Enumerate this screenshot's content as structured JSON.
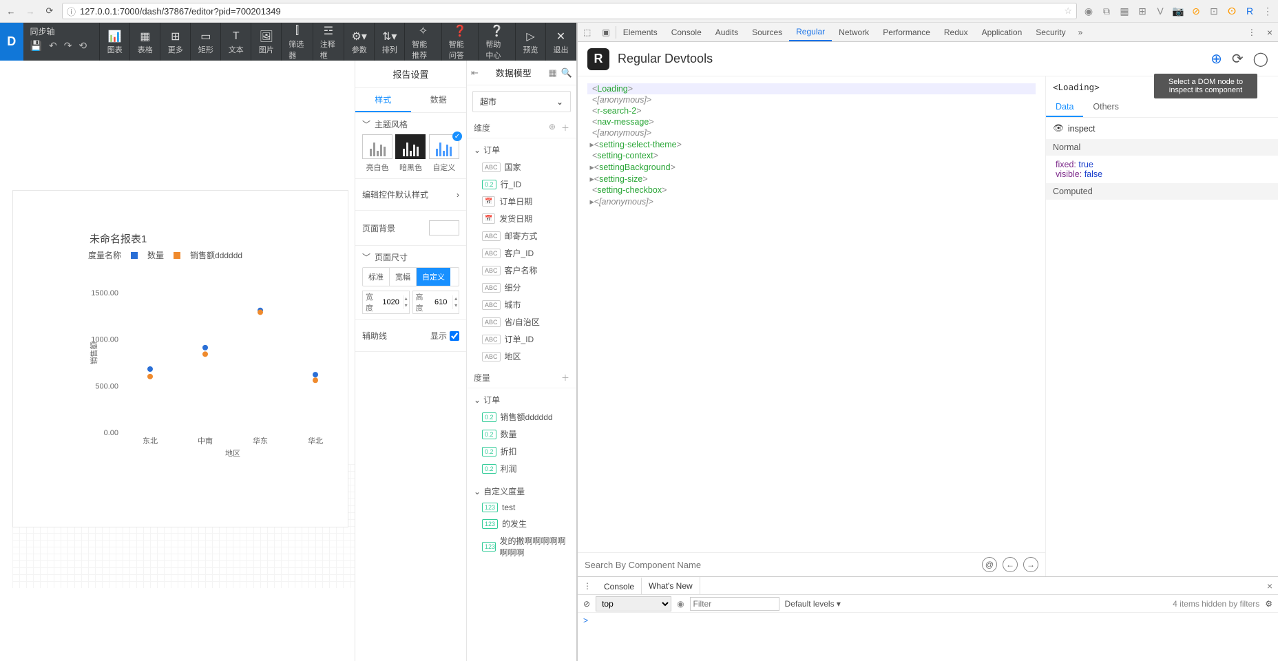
{
  "browser": {
    "url": "127.0.0.1:7000/dash/37867/editor?pid=700201349"
  },
  "toolbar": {
    "sync_title": "同步轴",
    "items": [
      {
        "label": "图表"
      },
      {
        "label": "表格"
      },
      {
        "label": "更多"
      },
      {
        "label": "矩形"
      },
      {
        "label": "文本"
      },
      {
        "label": "图片"
      },
      {
        "label": "筛选器"
      },
      {
        "label": "注释框"
      },
      {
        "label": "参数"
      },
      {
        "label": "排列"
      },
      {
        "label": "智能推荐"
      },
      {
        "label": "智能问答"
      },
      {
        "label": "帮助中心"
      },
      {
        "label": "预览"
      },
      {
        "label": "退出"
      }
    ]
  },
  "report": {
    "title": "未命名报表1",
    "legend_label": "度量名称",
    "legend_series1": "数量",
    "legend_series2": "销售额dddddd",
    "ylabel": "销售额",
    "xlabel": "地区"
  },
  "chart_data": {
    "type": "scatter",
    "title": "未命名报表1",
    "xlabel": "地区",
    "ylabel": "销售额",
    "ylim": [
      0,
      1700
    ],
    "yticks": [
      0.0,
      500.0,
      1000.0,
      1500.0
    ],
    "categories": [
      "东北",
      "中南",
      "华东",
      "华北"
    ],
    "series": [
      {
        "name": "数量",
        "color": "#2a6fd6",
        "values": [
          680,
          910,
          1310,
          620
        ]
      },
      {
        "name": "销售额dddddd",
        "color": "#ef8a2d",
        "values": [
          600,
          840,
          1290,
          560
        ]
      }
    ]
  },
  "config": {
    "panel_title": "报告设置",
    "tab_style": "样式",
    "tab_data": "数据",
    "sec_theme": "主题风格",
    "theme_white": "亮白色",
    "theme_dark": "暗黑色",
    "theme_custom": "自定义",
    "edit_default": "编辑控件默认样式",
    "sec_bg": "页面背景",
    "sec_size": "页面尺寸",
    "size_std": "标准",
    "size_wide": "宽幅",
    "size_custom": "自定义",
    "width_lbl": "宽度",
    "width_val": "1020",
    "height_lbl": "高度",
    "height_val": "610",
    "sec_guides": "辅助线",
    "show_lbl": "显示"
  },
  "data_model": {
    "panel_title": "数据模型",
    "select_value": "超市",
    "dim_title": "维度",
    "group_order": "订单",
    "fields_dim": [
      {
        "tag": "ABC",
        "label": "国家"
      },
      {
        "tag": "0.2",
        "label": "行_ID"
      },
      {
        "tag": "📅",
        "label": "订单日期"
      },
      {
        "tag": "📅",
        "label": "发货日期"
      },
      {
        "tag": "ABC",
        "label": "邮寄方式"
      },
      {
        "tag": "ABC",
        "label": "客户_ID"
      },
      {
        "tag": "ABC",
        "label": "客户名称"
      },
      {
        "tag": "ABC",
        "label": "细分"
      },
      {
        "tag": "ABC",
        "label": "城市"
      },
      {
        "tag": "ABC",
        "label": "省/自治区"
      },
      {
        "tag": "ABC",
        "label": "订单_ID"
      },
      {
        "tag": "ABC",
        "label": "地区"
      }
    ],
    "meas_title": "度量",
    "fields_meas": [
      {
        "tag": "0.2",
        "label": "销售额dddddd"
      },
      {
        "tag": "0.2",
        "label": "数量"
      },
      {
        "tag": "0.2",
        "label": "折扣"
      },
      {
        "tag": "0.2",
        "label": "利润"
      }
    ],
    "custom_meas": "自定义度量",
    "fields_custom": [
      {
        "tag": "123",
        "label": "test"
      },
      {
        "tag": "123",
        "label": "的发生"
      },
      {
        "tag": "123",
        "label": "发的撒啊啊啊啊啊啊啊啊"
      }
    ]
  },
  "devtools": {
    "tabs": [
      "Elements",
      "Console",
      "Audits",
      "Sources",
      "Regular",
      "Network",
      "Performance",
      "Redux",
      "Application",
      "Security"
    ],
    "regular_title": "Regular Devtools",
    "tooltip": "Select a DOM node to inspect its component",
    "tree": [
      {
        "text": "Loading",
        "kind": "tag",
        "sel": true
      },
      {
        "text": "[anonymous]",
        "kind": "anon"
      },
      {
        "text": "r-search-2",
        "kind": "tag"
      },
      {
        "text": "nav-message",
        "kind": "tag"
      },
      {
        "text": "[anonymous]",
        "kind": "anon"
      },
      {
        "text": "setting-select-theme",
        "kind": "tag",
        "caret": true
      },
      {
        "text": "setting-context",
        "kind": "tag"
      },
      {
        "text": "settingBackground",
        "kind": "tag",
        "caret": true
      },
      {
        "text": "setting-size",
        "kind": "tag",
        "caret": true
      },
      {
        "text": "setting-checkbox",
        "kind": "tag"
      },
      {
        "text": "[anonymous]",
        "kind": "anon",
        "caret": true
      }
    ],
    "search_placeholder": "Search By Component Name",
    "inspect_head": "<Loading>",
    "ip_tab_data": "Data",
    "ip_tab_others": "Others",
    "inspect_label": "inspect",
    "normal_label": "Normal",
    "prop_fixed_k": "fixed:",
    "prop_fixed_v": "true",
    "prop_visible_k": "visible:",
    "prop_visible_v": "false",
    "computed_label": "Computed"
  },
  "console": {
    "tab_console": "Console",
    "tab_whatsnew": "What's New",
    "ctx": "top",
    "filter_placeholder": "Filter",
    "levels": "Default levels ▾",
    "hidden": "4 items hidden by filters",
    "prompt": ">"
  }
}
